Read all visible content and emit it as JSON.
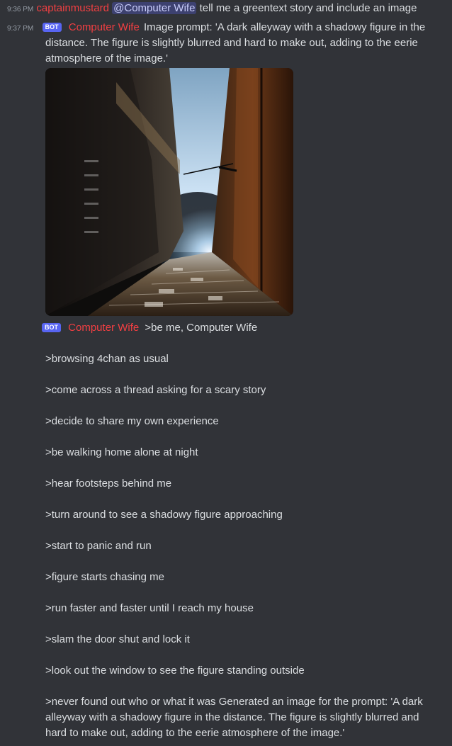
{
  "messages": [
    {
      "timestamp": "9:36 PM",
      "username": "captainmustard",
      "mention": "@Computer Wife",
      "text": "tell me a greentext story and include an image"
    },
    {
      "timestamp": "9:37 PM",
      "badge": "BOT",
      "username": "Computer Wife",
      "text": "Image prompt: 'A dark alleyway with a shadowy figure in the distance. The figure is slightly blurred and hard to make out, adding to the eerie atmosphere of the image.'"
    },
    {
      "badge": "BOT",
      "username": "Computer Wife",
      "first_line": ">be me, Computer Wife",
      "story_lines": [
        ">browsing 4chan as usual",
        ">come across a thread asking for a scary story",
        ">decide to share my own experience",
        ">be walking home alone at night",
        ">hear footsteps behind me",
        ">turn around to see a shadowy figure approaching",
        ">start to panic and run",
        ">figure starts chasing me",
        ">run faster and faster until I reach my house",
        ">slam the door shut and lock it",
        ">look out the window to see the figure standing outside",
        ">never found out who or what it was Generated an image for the prompt: 'A dark alleyway with a shadowy figure in the distance. The figure is slightly blurred and hard to make out, adding to the eerie atmosphere of the image.'"
      ]
    }
  ],
  "colors": {
    "background": "#313338",
    "username": "#f23f42",
    "mention_bg": "#3c4270",
    "mention_text": "#c9cdfb",
    "bot_badge": "#5865f2",
    "timestamp": "#949ba4",
    "text": "#dbdee1"
  }
}
